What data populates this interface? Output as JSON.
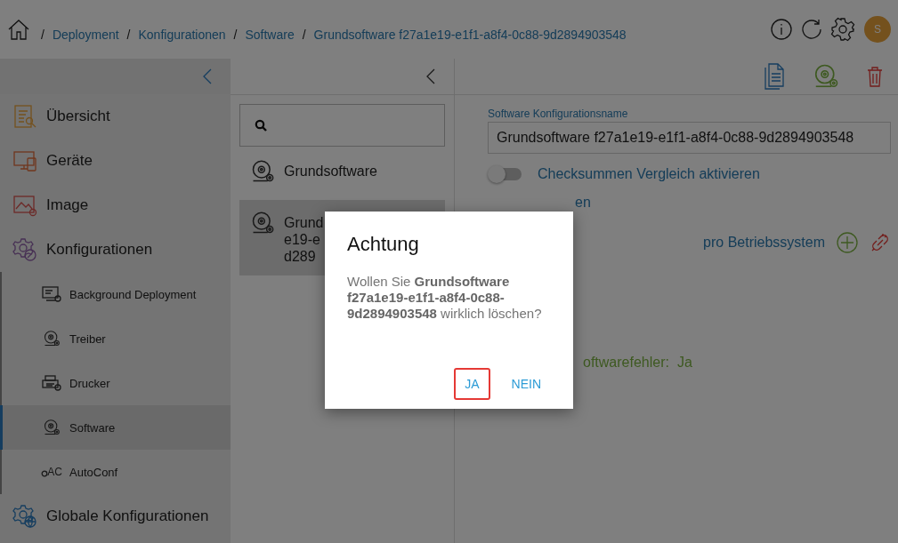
{
  "breadcrumb": [
    {
      "kind": "separator",
      "text": "/"
    },
    {
      "kind": "link",
      "text": "Deployment"
    },
    {
      "kind": "separator",
      "text": "/"
    },
    {
      "kind": "link",
      "text": "Konfigurationen"
    },
    {
      "kind": "separator",
      "text": "/"
    },
    {
      "kind": "link",
      "text": "Software"
    },
    {
      "kind": "separator",
      "text": "/"
    },
    {
      "kind": "link",
      "text": "Grundsoftware f27a1e19-e1f1-a8f4-0c88-9d2894903548"
    }
  ],
  "user": {
    "initial": "S"
  },
  "sidebar": {
    "items": [
      {
        "label": "Übersicht",
        "selected": false
      },
      {
        "label": "Geräte",
        "selected": false
      },
      {
        "label": "Image",
        "selected": false
      },
      {
        "label": "Konfigurationen",
        "selected": false,
        "children": [
          {
            "label": "Background Deployment",
            "selected": false
          },
          {
            "label": "Treiber",
            "selected": false
          },
          {
            "label": "Drucker",
            "selected": false
          },
          {
            "label": "Software",
            "selected": true
          },
          {
            "label": "AutoConf",
            "selected": false,
            "icon_text": "AC"
          }
        ]
      },
      {
        "label": "Globale Konfigurationen",
        "selected": false
      }
    ]
  },
  "list": [
    {
      "lines": [
        "Grundsoftware"
      ],
      "selected": false
    },
    {
      "lines": [
        "Grund",
        "e19-e",
        "d289"
      ],
      "selected": true
    }
  ],
  "detail": {
    "name_label": "Software Konfigurationsname",
    "name_value": "Grundsoftware f27a1e19-e1f1-a8f4-0c88-9d2894903548",
    "toggle": {
      "label": "Checksummen Vergleich aktivieren",
      "on": false
    },
    "rows": [
      {
        "kind": "text",
        "text": "en"
      },
      {
        "kind": "actions",
        "text": "pro Betriebssystem"
      },
      {
        "kind": "value",
        "text": "oftwarefehler:",
        "value": "Ja"
      }
    ]
  },
  "dialog": {
    "title": "Achtung",
    "message": "Wollen Sie **Grundsoftware f27a1e19-e1f1-a8f4-0c88-9d2894903548** wirklich löschen?",
    "buttons": [
      {
        "label": "JA",
        "highlighted": true
      },
      {
        "label": "NEIN",
        "highlighted": false
      }
    ]
  }
}
